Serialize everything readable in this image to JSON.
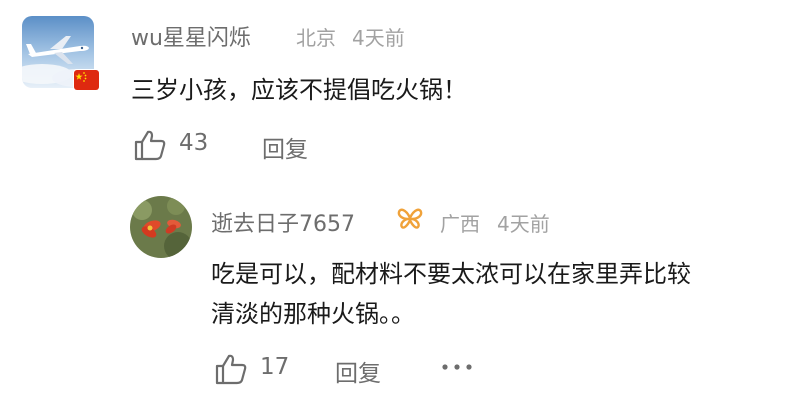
{
  "comment": {
    "username": "wu星星闪烁",
    "location": "北京",
    "time": "4天前",
    "text": "三岁小孩，应该不提倡吃火锅！",
    "likes": "43",
    "reply_label": "回复"
  },
  "reply": {
    "username": "逝去日子7657",
    "location": "广西",
    "time": "4天前",
    "text_line1": "吃是可以，配材料不要太浓可以在家里弄比较",
    "text_line2": "清淡的那种火锅。。",
    "likes": "17",
    "reply_label": "回复"
  },
  "icons": {
    "like": "thumbs-up-icon",
    "more": "more-dots-icon",
    "badge": "butterfly-badge-icon",
    "flag": "china-flag-icon"
  },
  "colors": {
    "badge": "#f0a23a",
    "flag_red": "#de2910",
    "flag_star": "#ffde00"
  }
}
